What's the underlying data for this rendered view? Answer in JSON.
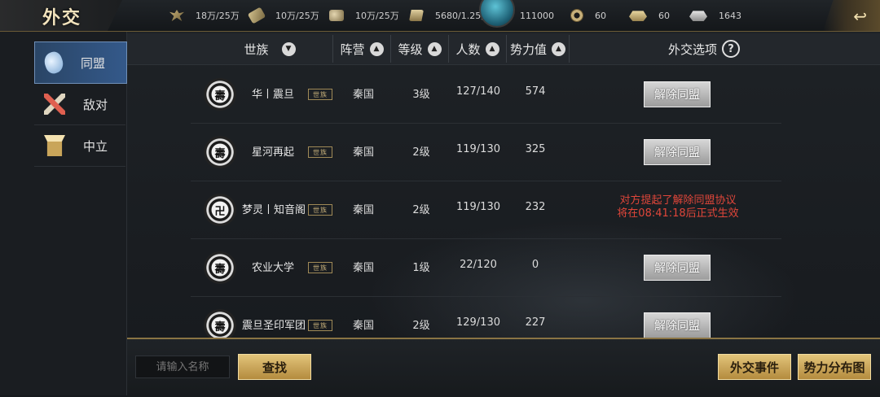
{
  "header": {
    "title": "外交",
    "resources": [
      {
        "icon": "grain-icon",
        "value": "18万/25万"
      },
      {
        "icon": "wood-icon",
        "value": "10万/25万"
      },
      {
        "icon": "stone-icon",
        "value": "10万/25万"
      },
      {
        "icon": "iron-icon",
        "value": "5680/1.25万"
      },
      {
        "icon": "population-icon",
        "value": "111000"
      },
      {
        "icon": "copper-coin-icon",
        "value": "60"
      },
      {
        "icon": "gold-ingot-icon",
        "value": "60"
      },
      {
        "icon": "silver-ingot-icon",
        "value": "1643"
      }
    ]
  },
  "sidebar": {
    "tabs": [
      {
        "label": "同盟",
        "icon": "alliance-icon",
        "active": true
      },
      {
        "label": "敌对",
        "icon": "crossed-swords-icon",
        "active": false
      },
      {
        "label": "中立",
        "icon": "neutral-banner-icon",
        "active": false
      }
    ]
  },
  "table": {
    "headers": {
      "clan": "世族",
      "faction": "阵营",
      "level": "等级",
      "members": "人数",
      "power": "势力值",
      "options": "外交选项"
    },
    "sort_glyph": "▲",
    "sort_glyph_down": "▼",
    "help_glyph": "?",
    "clan_badge": "世族",
    "dissolve_label": "解除同盟",
    "rows": [
      {
        "emblem": "壽",
        "name": "华丨震旦",
        "faction": "秦国",
        "level": "3级",
        "members": "127/140",
        "power": "574",
        "status": "button"
      },
      {
        "emblem": "壽",
        "name": "星河再起",
        "faction": "秦国",
        "level": "2级",
        "members": "119/130",
        "power": "325",
        "status": "button"
      },
      {
        "emblem": "卍",
        "name": "梦灵丨知音阁",
        "faction": "秦国",
        "level": "2级",
        "members": "119/130",
        "power": "232",
        "status": "pending",
        "notice_line1": "对方提起了解除同盟协议",
        "notice_line2": "将在08:41:18后正式生效"
      },
      {
        "emblem": "壽",
        "name": "农业大学",
        "faction": "秦国",
        "level": "1级",
        "members": "22/120",
        "power": "0",
        "status": "button"
      },
      {
        "emblem": "壽",
        "name": "震旦圣印军团",
        "faction": "秦国",
        "level": "2级",
        "members": "129/130",
        "power": "227",
        "status": "button"
      }
    ]
  },
  "footer": {
    "search_placeholder": "请输入名称",
    "search_button": "查找",
    "events_button": "外交事件",
    "map_button": "势力分布图"
  }
}
